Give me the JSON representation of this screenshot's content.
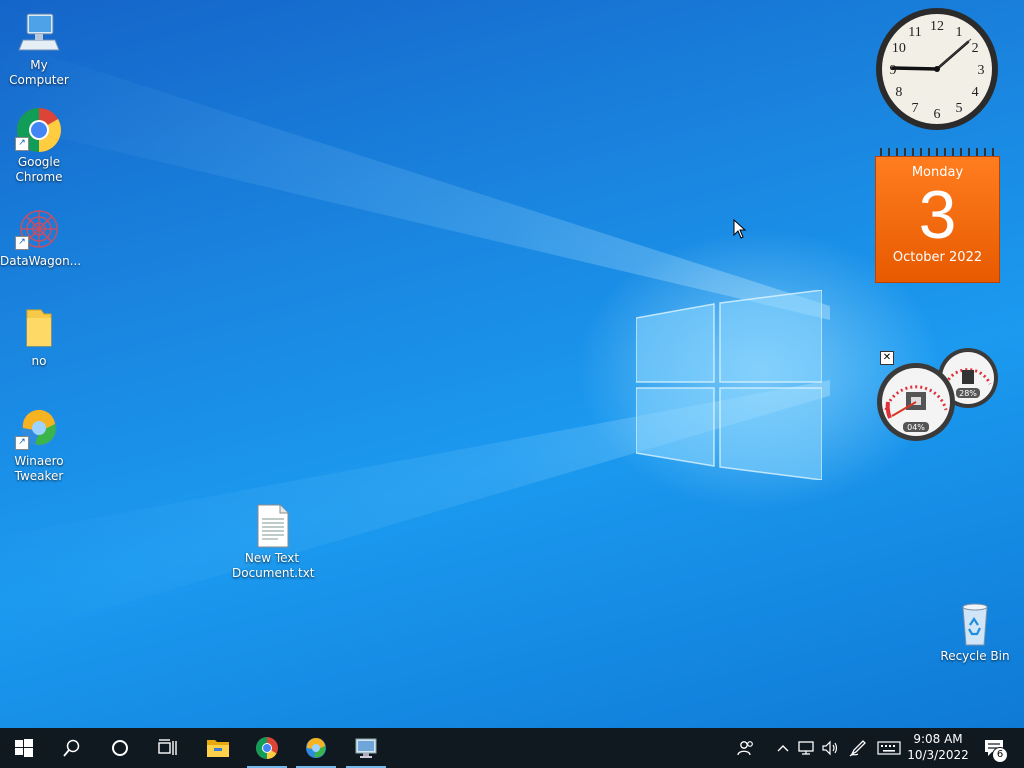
{
  "desktop": {
    "icons": [
      {
        "label": "My Computer",
        "icon": "computer-icon"
      },
      {
        "label": "Google Chrome",
        "icon": "chrome-icon"
      },
      {
        "label": "DataWagon...",
        "icon": "datawagon-icon"
      },
      {
        "label": "no",
        "icon": "folder-icon"
      },
      {
        "label": "Winaero Tweaker",
        "icon": "winaero-icon"
      },
      {
        "label": "New Text Document.txt",
        "icon": "text-file-icon"
      },
      {
        "label": "Recycle Bin",
        "icon": "recycle-bin-icon"
      }
    ]
  },
  "gadgets": {
    "clock": {
      "time": "9:08",
      "numerals": [
        "12",
        "1",
        "2",
        "3",
        "4",
        "5",
        "6",
        "7",
        "8",
        "9",
        "10",
        "11"
      ]
    },
    "calendar": {
      "weekday": "Monday",
      "day": "3",
      "month_year": "October 2022"
    },
    "cpu_meter": {
      "cpu_percent": "04%",
      "ram_percent": "28%"
    }
  },
  "taskbar": {
    "start": "start-icon",
    "search": "search-icon",
    "cortana": "cortana-icon",
    "task_view": "task-view-icon",
    "pinned": [
      "file-explorer-icon",
      "chrome-icon",
      "winaero-icon",
      "remote-desktop-icon"
    ],
    "tray": [
      "people-icon",
      "chevron-up-icon",
      "network-icon",
      "volume-icon",
      "pen-icon",
      "keyboard-icon"
    ],
    "time": "9:08 AM",
    "date": "10/3/2022",
    "notifications_count": "6"
  },
  "colors": {
    "accent": "#0078d7",
    "taskbar": "#101820",
    "calendar": "#f26b0f"
  }
}
